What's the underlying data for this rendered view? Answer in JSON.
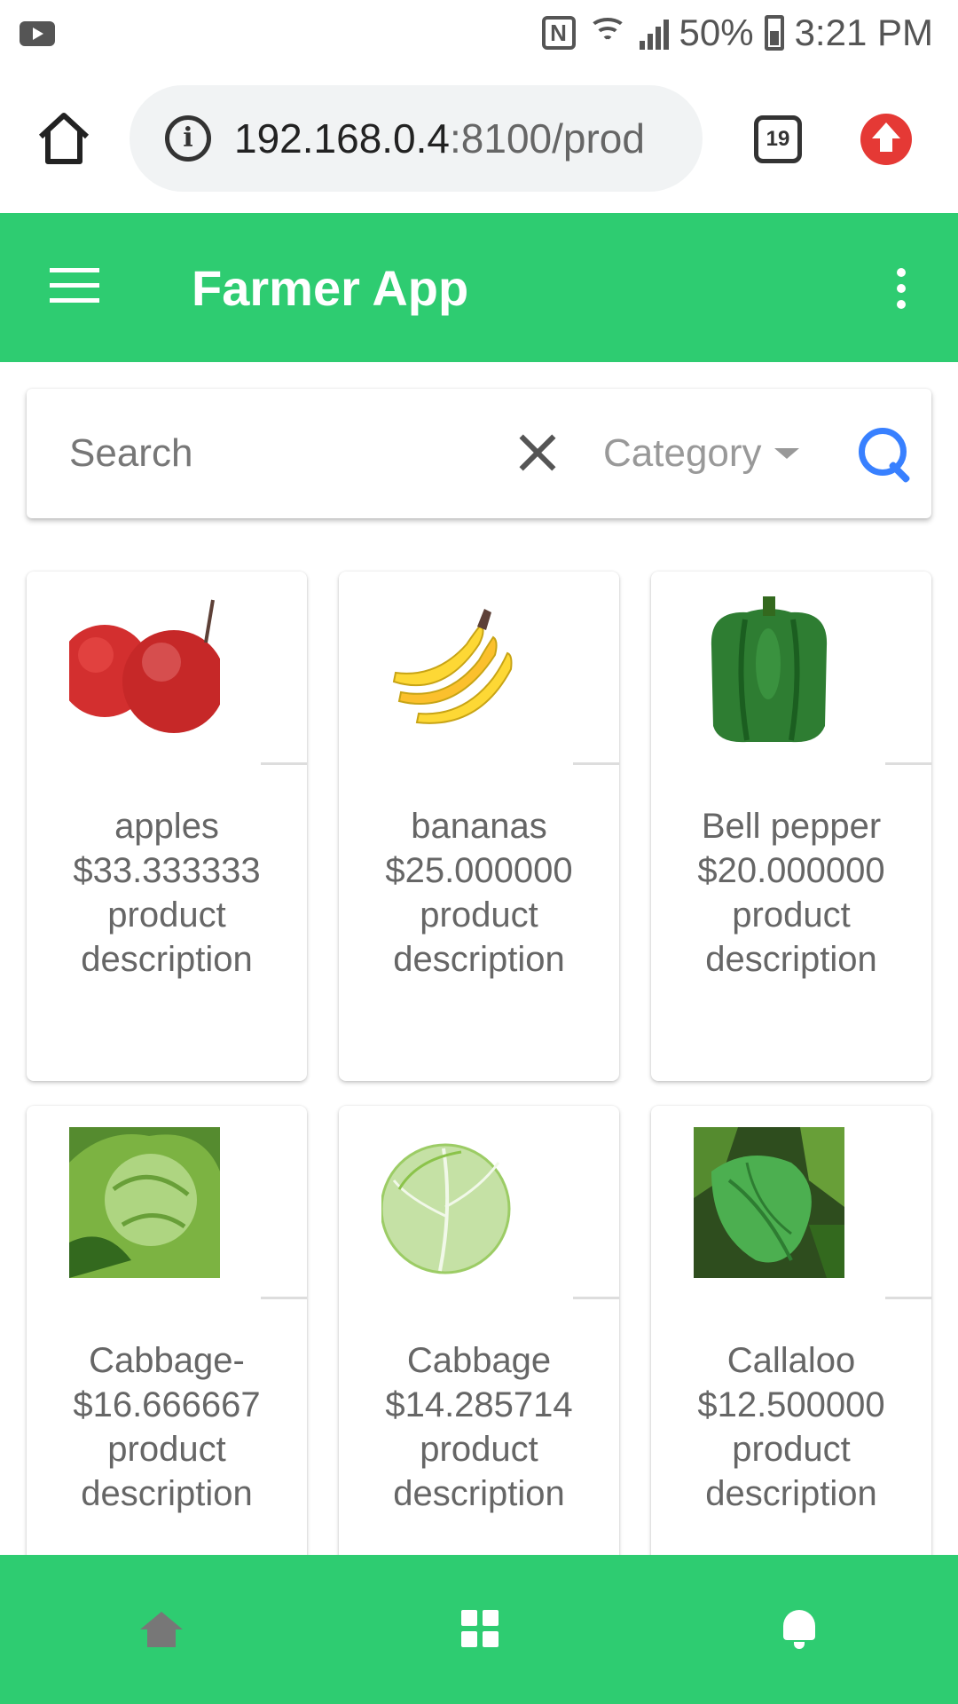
{
  "status_bar": {
    "battery": "50%",
    "time": "3:21 PM",
    "nfc_label": "N"
  },
  "browser": {
    "url_host": "192.168.0.4",
    "url_path": ":8100/prod",
    "tab_count": "19"
  },
  "toolbar": {
    "title": "Farmer App"
  },
  "search": {
    "placeholder": "Search",
    "category_label": "Category"
  },
  "products": [
    {
      "name": "apples",
      "price": "$33.333333",
      "description": "product description",
      "image": "apples"
    },
    {
      "name": "bananas",
      "price": "$25.000000",
      "description": "product description",
      "image": "bananas"
    },
    {
      "name": "Bell pepper",
      "price": "$20.000000",
      "description": "product description",
      "image": "bell-pepper"
    },
    {
      "name": "Cabbage-",
      "price": "$16.666667",
      "description": "product description",
      "image": "cabbage-leafy"
    },
    {
      "name": "Cabbage",
      "price": "$14.285714",
      "description": "product description",
      "image": "cabbage"
    },
    {
      "name": "Callaloo",
      "price": "$12.500000",
      "description": "product description",
      "image": "callaloo"
    }
  ],
  "tabbar": {
    "tabs": [
      {
        "icon": "home-icon",
        "selected": false
      },
      {
        "icon": "grid-icon",
        "selected": true
      },
      {
        "icon": "bell-icon",
        "selected": false
      }
    ]
  },
  "colors": {
    "primary": "#2ecc71",
    "search_accent": "#3880ff",
    "upgrade": "#e53935"
  }
}
